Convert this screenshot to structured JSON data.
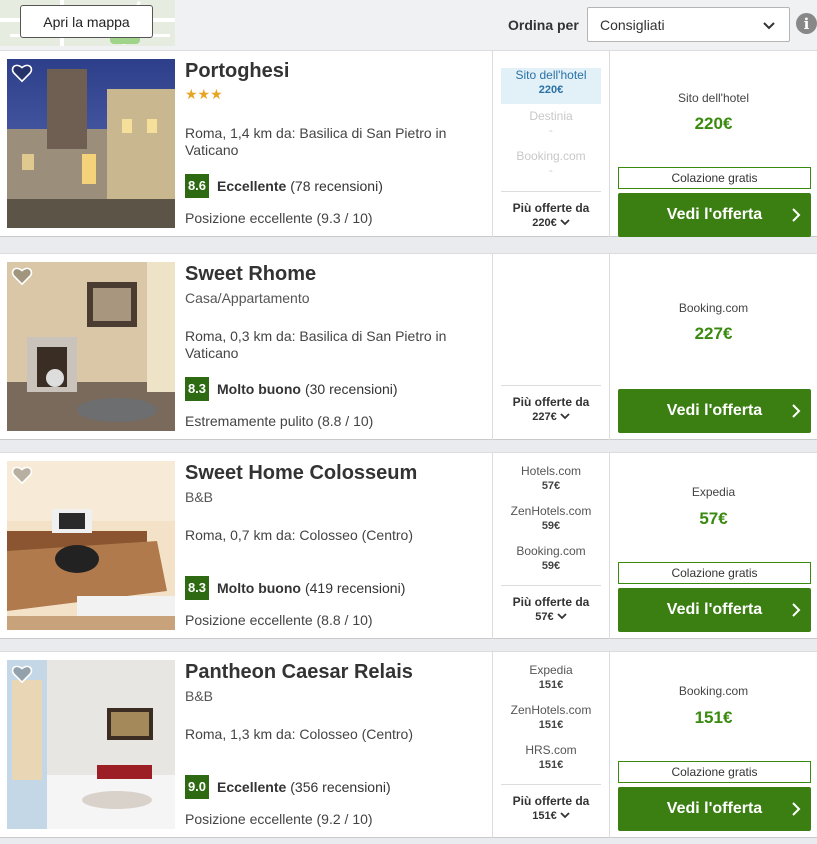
{
  "topbar": {
    "map_button": "Apri la mappa",
    "sort_label": "Ordina per",
    "sort_value": "Consigliati"
  },
  "colors": {
    "accent_green": "#3b7f12",
    "price_green": "#3a8a0f",
    "rating_badge": "#2e6a12",
    "highlight_blue": "#2a72a6"
  },
  "hotels": [
    {
      "name": "Portoghesi",
      "stars": "★★★",
      "address": "Roma, 1,4 km da: Basilica di San Pietro in Vaticano",
      "score": "8.6",
      "rating_label": "Eccellente",
      "reviews": "(78 recensioni)",
      "position": "Posizione eccellente (9.3 / 10)",
      "offers": [
        {
          "provider": "Sito dell'hotel",
          "price": "220€"
        },
        {
          "provider": "Destinia",
          "price": "-"
        },
        {
          "provider": "Booking.com",
          "price": "-"
        }
      ],
      "more_label": "Più offerte da",
      "more_price": "220€",
      "best_provider": "Sito dell'hotel",
      "best_price": "220€",
      "free_breakfast": "Colazione gratis",
      "cta": "Vedi l'offerta"
    },
    {
      "name": "Sweet Rhome",
      "type": "Casa/Appartamento",
      "address": "Roma, 0,3 km da: Basilica di San Pietro in Vaticano",
      "score": "8.3",
      "rating_label": "Molto buono",
      "reviews": "(30 recensioni)",
      "position": "Estremamente pulito (8.8 / 10)",
      "more_label": "Più offerte da",
      "more_price": "227€",
      "best_provider": "Booking.com",
      "best_price": "227€",
      "cta": "Vedi l'offerta"
    },
    {
      "name": "Sweet Home Colosseum",
      "type": "B&B",
      "address": "Roma, 0,7 km da: Colosseo (Centro)",
      "score": "8.3",
      "rating_label": "Molto buono",
      "reviews": "(419 recensioni)",
      "position": "Posizione eccellente (8.8 / 10)",
      "offers": [
        {
          "provider": "Hotels.com",
          "price": "57€"
        },
        {
          "provider": "ZenHotels.com",
          "price": "59€"
        },
        {
          "provider": "Booking.com",
          "price": "59€"
        }
      ],
      "more_label": "Più offerte da",
      "more_price": "57€",
      "best_provider": "Expedia",
      "best_price": "57€",
      "free_breakfast": "Colazione gratis",
      "cta": "Vedi l'offerta"
    },
    {
      "name": "Pantheon Caesar Relais",
      "type": "B&B",
      "address": "Roma, 1,3 km da: Colosseo (Centro)",
      "score": "9.0",
      "rating_label": "Eccellente",
      "reviews": "(356 recensioni)",
      "position": "Posizione eccellente (9.2 / 10)",
      "offers": [
        {
          "provider": "Expedia",
          "price": "151€"
        },
        {
          "provider": "ZenHotels.com",
          "price": "151€"
        },
        {
          "provider": "HRS.com",
          "price": "151€"
        }
      ],
      "more_label": "Più offerte da",
      "more_price": "151€",
      "best_provider": "Booking.com",
      "best_price": "151€",
      "free_breakfast": "Colazione gratis",
      "cta": "Vedi l'offerta"
    }
  ]
}
